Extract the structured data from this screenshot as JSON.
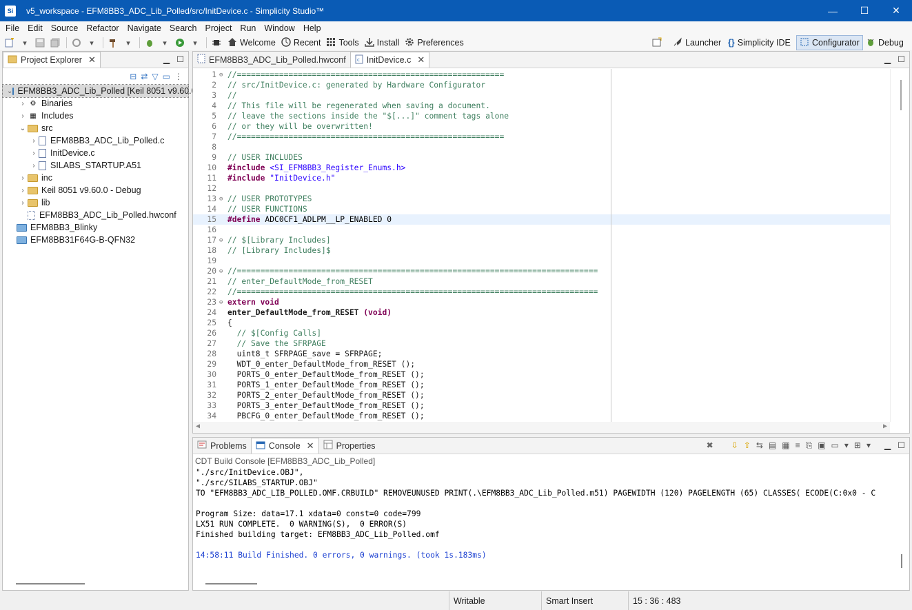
{
  "window": {
    "title": "v5_workspace - EFM8BB3_ADC_Lib_Polled/src/InitDevice.c - Simplicity Studio™",
    "app_icon": "Si",
    "minimize": "—",
    "maximize": "☐",
    "close": "✕"
  },
  "menu": {
    "items": [
      "File",
      "Edit",
      "Source",
      "Refactor",
      "Navigate",
      "Search",
      "Project",
      "Run",
      "Window",
      "Help"
    ]
  },
  "toolbar": {
    "welcome": "Welcome",
    "recent": "Recent",
    "tools": "Tools",
    "install": "Install",
    "preferences": "Preferences"
  },
  "perspectives": {
    "launcher": "Launcher",
    "ide": "Simplicity IDE",
    "configurator": "Configurator",
    "debug": "Debug"
  },
  "project_explorer": {
    "tab_label": "Project Explorer",
    "tree": [
      {
        "label": "EFM8BB3_ADC_Lib_Polled [Keil 8051 v9.60.0",
        "depth": 0,
        "chev": "⌄",
        "icon": "project"
      },
      {
        "label": "Binaries",
        "depth": 1,
        "chev": "›",
        "icon": "binaries"
      },
      {
        "label": "Includes",
        "depth": 1,
        "chev": "›",
        "icon": "includes"
      },
      {
        "label": "src",
        "depth": 1,
        "chev": "⌄",
        "icon": "folder"
      },
      {
        "label": "EFM8BB3_ADC_Lib_Polled.c",
        "depth": 2,
        "chev": "›",
        "icon": "cfile"
      },
      {
        "label": "InitDevice.c",
        "depth": 2,
        "chev": "›",
        "icon": "cfile"
      },
      {
        "label": "SILABS_STARTUP.A51",
        "depth": 2,
        "chev": "›",
        "icon": "asmfile"
      },
      {
        "label": "inc",
        "depth": 1,
        "chev": "›",
        "icon": "folder"
      },
      {
        "label": "Keil 8051 v9.60.0 - Debug",
        "depth": 1,
        "chev": "›",
        "icon": "folder"
      },
      {
        "label": "lib",
        "depth": 1,
        "chev": "›",
        "icon": "folder"
      },
      {
        "label": "EFM8BB3_ADC_Lib_Polled.hwconf",
        "depth": 1,
        "chev": "",
        "icon": "hwconf"
      },
      {
        "label": "EFM8BB3_Blinky",
        "depth": 0,
        "chev": "",
        "icon": "closedproject"
      },
      {
        "label": "EFM8BB31F64G-B-QFN32",
        "depth": 0,
        "chev": "",
        "icon": "closedproject"
      }
    ]
  },
  "editor": {
    "tabs": [
      {
        "label": "EFM8BB3_ADC_Lib_Polled.hwconf",
        "active": false
      },
      {
        "label": "InitDevice.c",
        "active": true
      }
    ],
    "lines": [
      {
        "n": "1",
        "fold": "⊖",
        "t": "//=========================================================",
        "k": "comment"
      },
      {
        "n": "2",
        "fold": "",
        "t": "// src/InitDevice.c: generated by Hardware Configurator",
        "k": "comment"
      },
      {
        "n": "3",
        "fold": "",
        "t": "//",
        "k": "comment"
      },
      {
        "n": "4",
        "fold": "",
        "t": "// This file will be regenerated when saving a document.",
        "k": "comment"
      },
      {
        "n": "5",
        "fold": "",
        "t": "// leave the sections inside the \"$[...]\" comment tags alone",
        "k": "comment"
      },
      {
        "n": "6",
        "fold": "",
        "t": "// or they will be overwritten!",
        "k": "comment"
      },
      {
        "n": "7",
        "fold": "",
        "t": "//=========================================================",
        "k": "comment"
      },
      {
        "n": "8",
        "fold": "",
        "t": "",
        "k": "plain"
      },
      {
        "n": "9",
        "fold": "",
        "t": "// USER INCLUDES",
        "k": "comment"
      },
      {
        "n": "10",
        "fold": "",
        "t": "#include <SI_EFM8BB3_Register_Enums.h>",
        "k": "include"
      },
      {
        "n": "11",
        "fold": "",
        "t": "#include \"InitDevice.h\"",
        "k": "include"
      },
      {
        "n": "12",
        "fold": "",
        "t": "",
        "k": "plain"
      },
      {
        "n": "13",
        "fold": "⊖",
        "t": "// USER PROTOTYPES",
        "k": "comment"
      },
      {
        "n": "14",
        "fold": "",
        "t": "// USER FUNCTIONS",
        "k": "comment"
      },
      {
        "n": "15",
        "fold": "",
        "t": "#define ADC0CF1_ADLPM__LP_ENABLED 0",
        "k": "define"
      },
      {
        "n": "16",
        "fold": "",
        "t": "",
        "k": "plain"
      },
      {
        "n": "17",
        "fold": "⊖",
        "t": "// $[Library Includes]",
        "k": "comment"
      },
      {
        "n": "18",
        "fold": "",
        "t": "// [Library Includes]$",
        "k": "comment"
      },
      {
        "n": "19",
        "fold": "",
        "t": "",
        "k": "plain"
      },
      {
        "n": "20",
        "fold": "⊖",
        "t": "//=============================================================================",
        "k": "comment"
      },
      {
        "n": "21",
        "fold": "",
        "t": "// enter_DefaultMode_from_RESET",
        "k": "comment"
      },
      {
        "n": "22",
        "fold": "",
        "t": "//=============================================================================",
        "k": "comment"
      },
      {
        "n": "23",
        "fold": "⊖",
        "t": "extern void",
        "k": "keyword"
      },
      {
        "n": "24",
        "fold": "",
        "t": "enter_DefaultMode_from_RESET (void)",
        "k": "funcdecl"
      },
      {
        "n": "25",
        "fold": "",
        "t": "{",
        "k": "plain"
      },
      {
        "n": "26",
        "fold": "",
        "t": "  // $[Config Calls]",
        "k": "comment"
      },
      {
        "n": "27",
        "fold": "",
        "t": "  // Save the SFRPAGE",
        "k": "comment"
      },
      {
        "n": "28",
        "fold": "",
        "t": "  uint8_t SFRPAGE_save = SFRPAGE;",
        "k": "plain"
      },
      {
        "n": "29",
        "fold": "",
        "t": "  WDT_0_enter_DefaultMode_from_RESET ();",
        "k": "plain"
      },
      {
        "n": "30",
        "fold": "",
        "t": "  PORTS_0_enter_DefaultMode_from_RESET ();",
        "k": "plain"
      },
      {
        "n": "31",
        "fold": "",
        "t": "  PORTS_1_enter_DefaultMode_from_RESET ();",
        "k": "plain"
      },
      {
        "n": "32",
        "fold": "",
        "t": "  PORTS_2_enter_DefaultMode_from_RESET ();",
        "k": "plain"
      },
      {
        "n": "33",
        "fold": "",
        "t": "  PORTS_3_enter_DefaultMode_from_RESET ();",
        "k": "plain"
      },
      {
        "n": "34",
        "fold": "",
        "t": "  PBCFG_0_enter_DefaultMode_from_RESET ();",
        "k": "plain"
      }
    ],
    "current_line": "15"
  },
  "bottom_panel": {
    "tabs": [
      {
        "label": "Problems",
        "active": false
      },
      {
        "label": "Console",
        "active": true
      },
      {
        "label": "Properties",
        "active": false
      }
    ],
    "console_title": "CDT Build Console [EFM8BB3_ADC_Lib_Polled]",
    "lines": [
      {
        "t": "\"./src/InitDevice.OBJ\",",
        "blue": false
      },
      {
        "t": "\"./src/SILABS_STARTUP.OBJ\"",
        "blue": false
      },
      {
        "t": "TO \"EFM8BB3_ADC_LIB_POLLED.OMF.CRBUILD\" REMOVEUNUSED PRINT(.\\EFM8BB3_ADC_Lib_Polled.m51) PAGEWIDTH (120) PAGELENGTH (65) CLASSES( ECODE(C:0x0 - C",
        "blue": false
      },
      {
        "t": "",
        "blue": false
      },
      {
        "t": "Program Size: data=17.1 xdata=0 const=0 code=799",
        "blue": false
      },
      {
        "t": "LX51 RUN COMPLETE.  0 WARNING(S),  0 ERROR(S)",
        "blue": false
      },
      {
        "t": "Finished building target: EFM8BB3_ADC_Lib_Polled.omf",
        "blue": false
      },
      {
        "t": "",
        "blue": false
      },
      {
        "t": "14:58:11 Build Finished. 0 errors, 0 warnings. (took 1s.183ms)",
        "blue": true
      }
    ]
  },
  "statusbar": {
    "writable": "Writable",
    "insert_mode": "Smart Insert",
    "position": "15 : 36 : 483"
  },
  "colors": {
    "titlebar": "#0a5bb5",
    "comment": "#3f7f5f",
    "keyword": "#7f0055",
    "string": "#2a00ff",
    "console_info": "#1a3fd1"
  }
}
